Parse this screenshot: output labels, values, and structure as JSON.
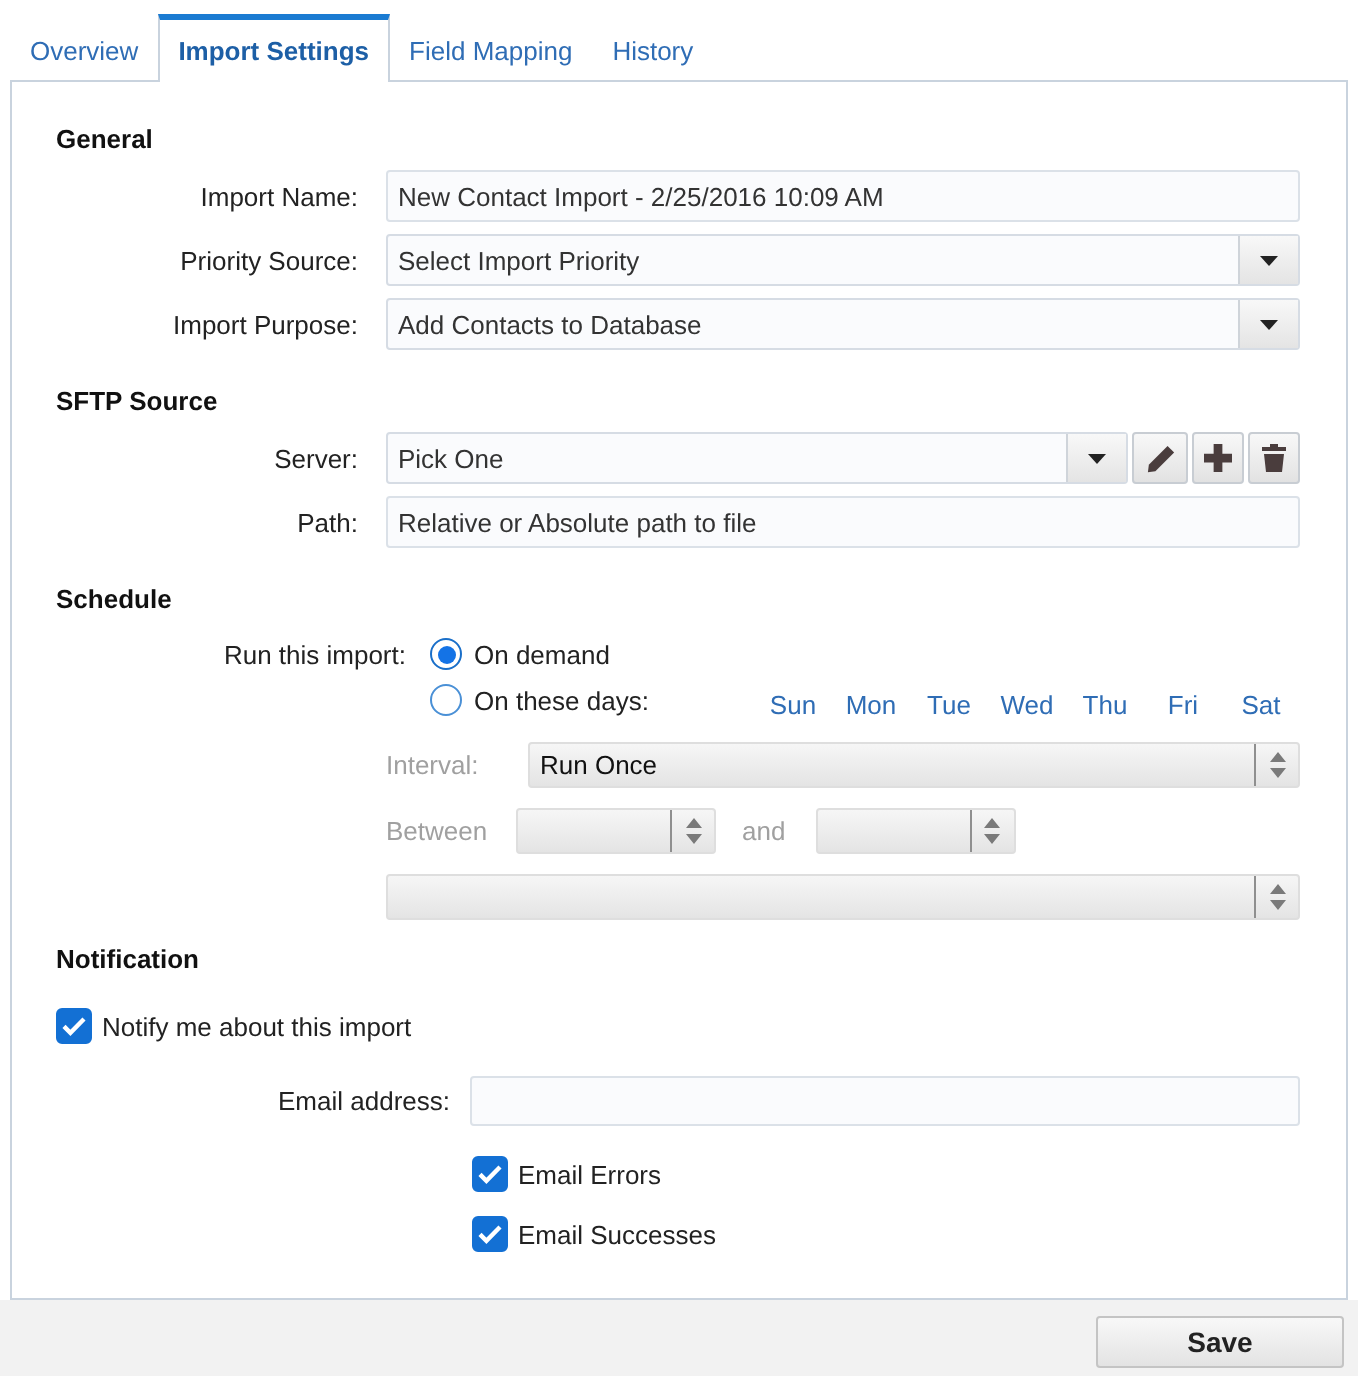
{
  "tabs": [
    {
      "label": "Overview",
      "selected": false
    },
    {
      "label": "Import Settings",
      "selected": true
    },
    {
      "label": "Field Mapping",
      "selected": false
    },
    {
      "label": "History",
      "selected": false
    }
  ],
  "general": {
    "heading": "General",
    "fields": [
      {
        "kind": "text",
        "label": "Import Name:",
        "value": "New Contact Import - 2/25/2016 10:09 AM"
      },
      {
        "kind": "select",
        "label": "Priority Source:",
        "value": "Select Import Priority"
      },
      {
        "kind": "select",
        "label": "Import Purpose:",
        "value": "Add Contacts to Database"
      }
    ]
  },
  "sftp_source": {
    "heading": "SFTP Source",
    "server": {
      "label": "Server:",
      "value": "Pick One"
    },
    "path": {
      "label": "Path:",
      "placeholder": "Relative or Absolute path to file"
    }
  },
  "schedule": {
    "heading": "Schedule",
    "run_label": "Run this import:",
    "run_options": [
      {
        "label": "On demand",
        "selected": true
      },
      {
        "label": "On these days:",
        "selected": false,
        "days": [
          "Sun",
          "Mon",
          "Tue",
          "Wed",
          "Thu",
          "Fri",
          "Sat"
        ]
      }
    ],
    "recurrence": {
      "disabled": true,
      "interval_label": "Interval:",
      "interval_value": "Run Once",
      "between_label": "Between",
      "and_label": "and"
    }
  },
  "notification": {
    "heading": "Notification",
    "notify": {
      "label": "Notify me about this import",
      "checked": true
    },
    "email_label": "Email address:",
    "email_options": [
      {
        "label": "Email Errors",
        "checked": true
      },
      {
        "label": "Email Successes",
        "checked": true
      }
    ]
  },
  "footer": {
    "save_label": "Save"
  }
}
